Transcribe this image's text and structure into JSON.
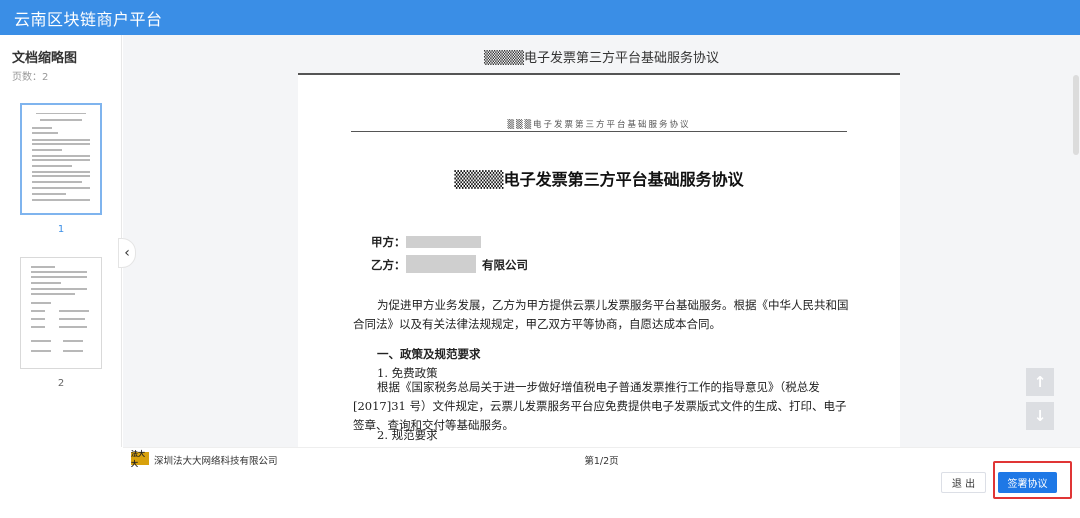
{
  "app": {
    "title": "云南区块链商户平台"
  },
  "sidebar": {
    "title": "文档缩略图",
    "page_count": "页数：2",
    "thumbnails": [
      {
        "label": "1",
        "active": true
      },
      {
        "label": "2",
        "active": false
      }
    ]
  },
  "document": {
    "header_title": "▒▒▒▒电子发票第三方平台基础服务协议",
    "running_header": "▒▒▒电子发票第三方平台基础服务协议",
    "title": "▒▒▒▒电子发票第三方平台基础服务协议",
    "party_a_label": "甲方：",
    "party_b_label": "乙方：",
    "party_b_suffix": "有限公司",
    "intro": "为促进甲方业务发展，乙方为甲方提供云票儿发票服务平台基础服务。根据《中华人民共和国合同法》以及有关法律法规规定，甲乙双方平等协商，自愿达成本合同。",
    "section1_heading": "一、政策及规范要求",
    "item1_heading": "1. 免费政策",
    "item1_text": "根据《国家税务总局关于进一步做好增值税电子普通发票推行工作的指导意见》（税总发[2017]31 号）文件规定，云票儿发票服务平台应免费提供电子发票版式文件的生成、打印、电子签章、查询和交付等基础服务。",
    "item2_heading": "2. 规范要求"
  },
  "footer": {
    "company_logo_text": "法大大",
    "company_name": "深圳法大大网络科技有限公司",
    "page_indicator": "第1/2页"
  },
  "actions": {
    "exit_label": "退 出",
    "sign_label": "签署协议"
  },
  "colors": {
    "topbar": "#3a8ee6",
    "primary_button": "#1e78e6",
    "highlight": "#e03535"
  },
  "icons": {
    "collapse": "chevron-left-icon",
    "scroll_up": "arrow-up-icon",
    "scroll_down": "arrow-down-icon"
  }
}
